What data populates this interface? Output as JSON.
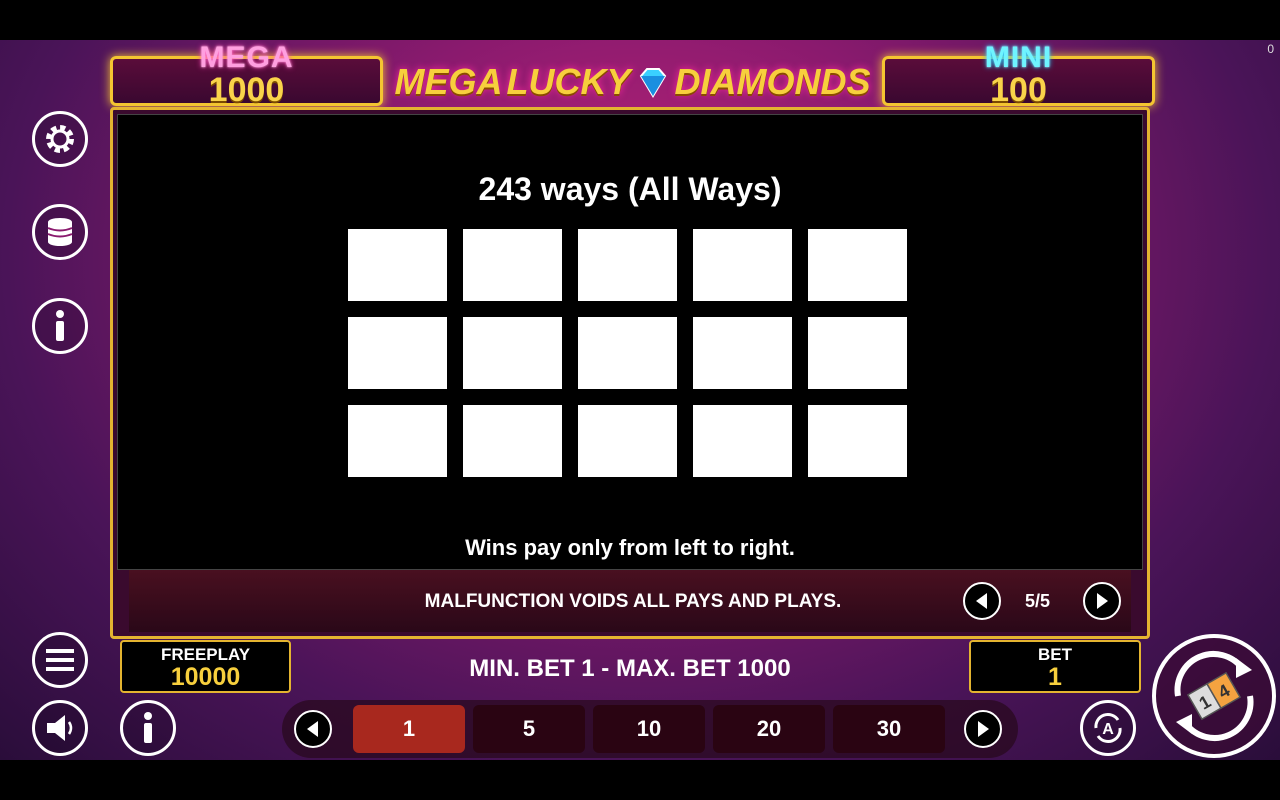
{
  "corner_counter": "0",
  "jackpots": {
    "mega": {
      "label": "MEGA",
      "value": "1000"
    },
    "mini": {
      "label": "MINI",
      "value": "100"
    }
  },
  "logo": {
    "word1": "MEGA",
    "word2": "LUCKY",
    "word3": "DIAMONDS"
  },
  "paytable": {
    "title": "243 ways (All Ways)",
    "grid_rows": 3,
    "grid_cols": 5,
    "note": "Wins pay only from left to right."
  },
  "footer_notice": "MALFUNCTION VOIDS ALL PAYS AND PLAYS.",
  "pager": {
    "current": "5/5"
  },
  "freeplay": {
    "label": "FREEPLAY",
    "value": "10000"
  },
  "bet_limits": "MIN. BET 1 - MAX. BET 1000",
  "bet": {
    "label": "BET",
    "value": "1"
  },
  "bet_options": [
    "1",
    "5",
    "10",
    "20",
    "30"
  ],
  "selected_bet": "1",
  "spin_badge": {
    "a": "1",
    "b": "4"
  },
  "colors": {
    "gold": "#f4c531",
    "mega_pink": "#ff9fe0",
    "mini_cyan": "#6ff4ff",
    "active_bet": "#a8281e"
  }
}
